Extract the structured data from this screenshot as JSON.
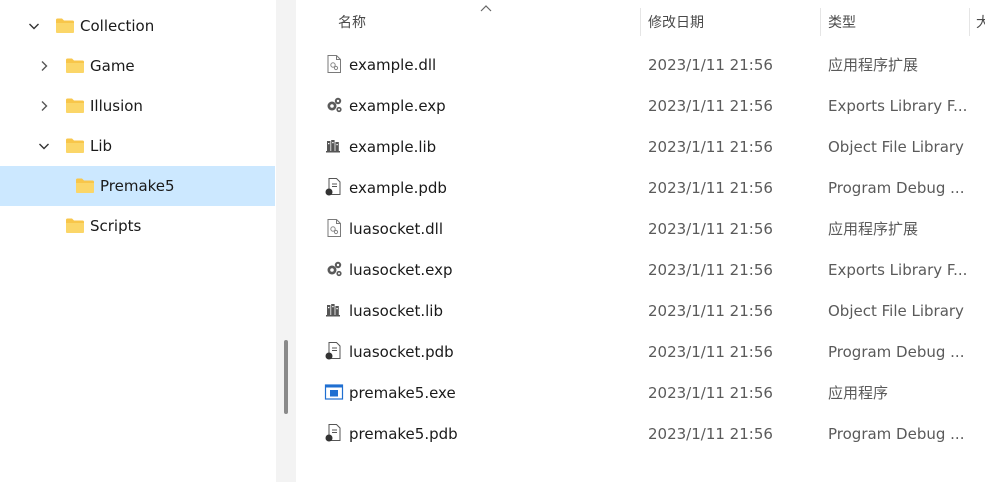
{
  "nav": {
    "items": [
      {
        "label": "Collection",
        "expanded": true
      },
      {
        "label": "Game",
        "expanded": false
      },
      {
        "label": "Illusion",
        "expanded": false
      },
      {
        "label": "Lib",
        "expanded": true
      },
      {
        "label": "Premake5",
        "selected": true
      },
      {
        "label": "Scripts"
      }
    ]
  },
  "columns": {
    "name": "名称",
    "date": "修改日期",
    "type": "类型",
    "size": "大"
  },
  "files": [
    {
      "name": "example.dll",
      "date": "2023/1/11 21:56",
      "type": "应用程序扩展",
      "icon": "dll-icon"
    },
    {
      "name": "example.exp",
      "date": "2023/1/11 21:56",
      "type": "Exports Library F...",
      "icon": "exp-gears-icon"
    },
    {
      "name": "example.lib",
      "date": "2023/1/11 21:56",
      "type": "Object File Library",
      "icon": "lib-books-icon"
    },
    {
      "name": "example.pdb",
      "date": "2023/1/11 21:56",
      "type": "Program Debug ...",
      "icon": "pdb-icon"
    },
    {
      "name": "luasocket.dll",
      "date": "2023/1/11 21:56",
      "type": "应用程序扩展",
      "icon": "dll-icon"
    },
    {
      "name": "luasocket.exp",
      "date": "2023/1/11 21:56",
      "type": "Exports Library F...",
      "icon": "exp-gears-icon"
    },
    {
      "name": "luasocket.lib",
      "date": "2023/1/11 21:56",
      "type": "Object File Library",
      "icon": "lib-books-icon"
    },
    {
      "name": "luasocket.pdb",
      "date": "2023/1/11 21:56",
      "type": "Program Debug ...",
      "icon": "pdb-icon"
    },
    {
      "name": "premake5.exe",
      "date": "2023/1/11 21:56",
      "type": "应用程序",
      "icon": "exe-window-icon"
    },
    {
      "name": "premake5.pdb",
      "date": "2023/1/11 21:56",
      "type": "Program Debug ...",
      "icon": "pdb-icon"
    }
  ],
  "colors": {
    "selection": "#cce8ff",
    "folder": "#f8c64a",
    "exe_blue": "#1f6fd1"
  }
}
